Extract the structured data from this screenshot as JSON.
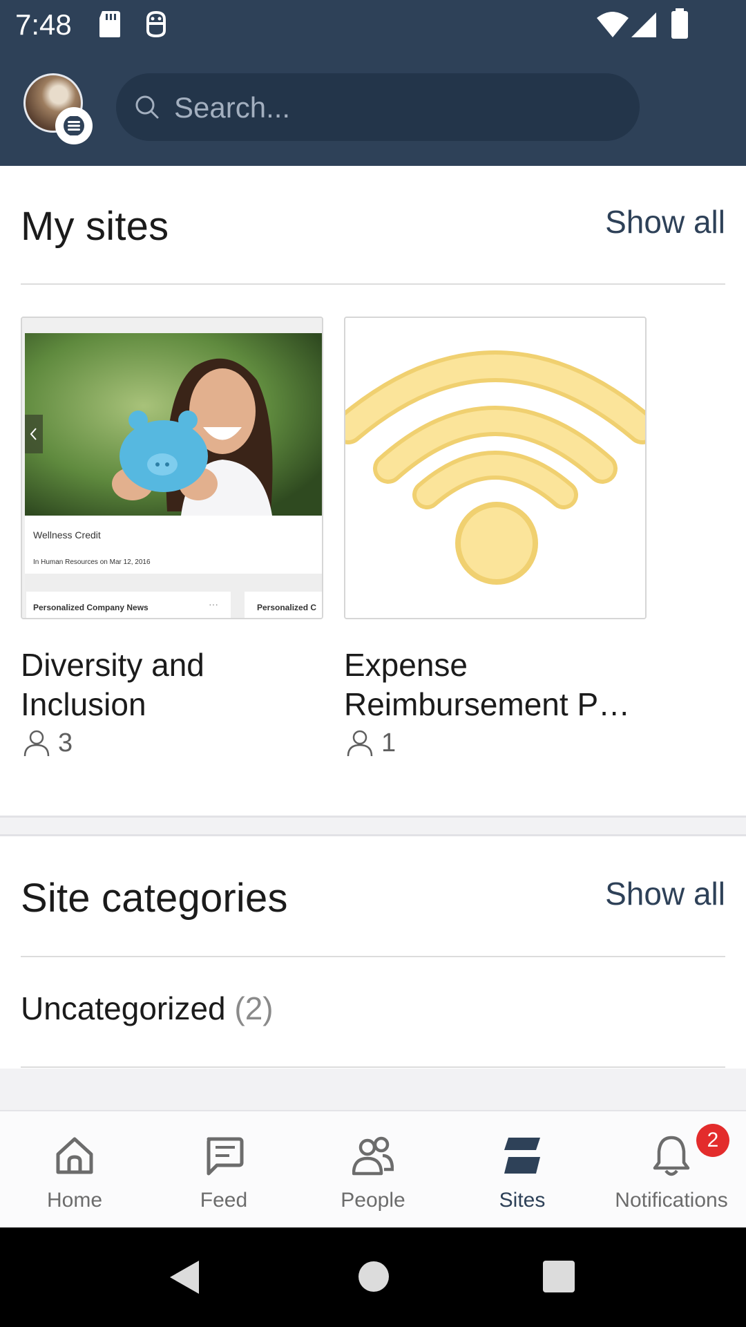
{
  "status_bar": {
    "time": "7:48"
  },
  "search": {
    "placeholder": "Search..."
  },
  "my_sites": {
    "title": "My sites",
    "show_all": "Show all",
    "sites": [
      {
        "name": "Diversity and Inclusion",
        "members": "3",
        "thumb": {
          "post_title": "Wellness Credit",
          "post_meta": "In Human Resources on Mar 12, 2016",
          "tab_1": "Personalized Company News",
          "tab_2": "Personalized C",
          "more": "···"
        }
      },
      {
        "name": "Expense Reimbursement P…",
        "members": "1"
      }
    ]
  },
  "site_categories": {
    "title": "Site categories",
    "show_all": "Show all",
    "items": [
      {
        "name": "Uncategorized",
        "count": "(2)"
      }
    ]
  },
  "bottom_nav": {
    "items": [
      {
        "label": "Home",
        "icon": "home-icon"
      },
      {
        "label": "Feed",
        "icon": "feed-icon"
      },
      {
        "label": "People",
        "icon": "people-icon"
      },
      {
        "label": "Sites",
        "icon": "sites-icon",
        "active": true
      },
      {
        "label": "Notifications",
        "icon": "bell-icon",
        "badge": "2"
      }
    ]
  },
  "colors": {
    "header": "#2e4158",
    "accent": "#2e4158",
    "badge": "#e32c2c"
  }
}
